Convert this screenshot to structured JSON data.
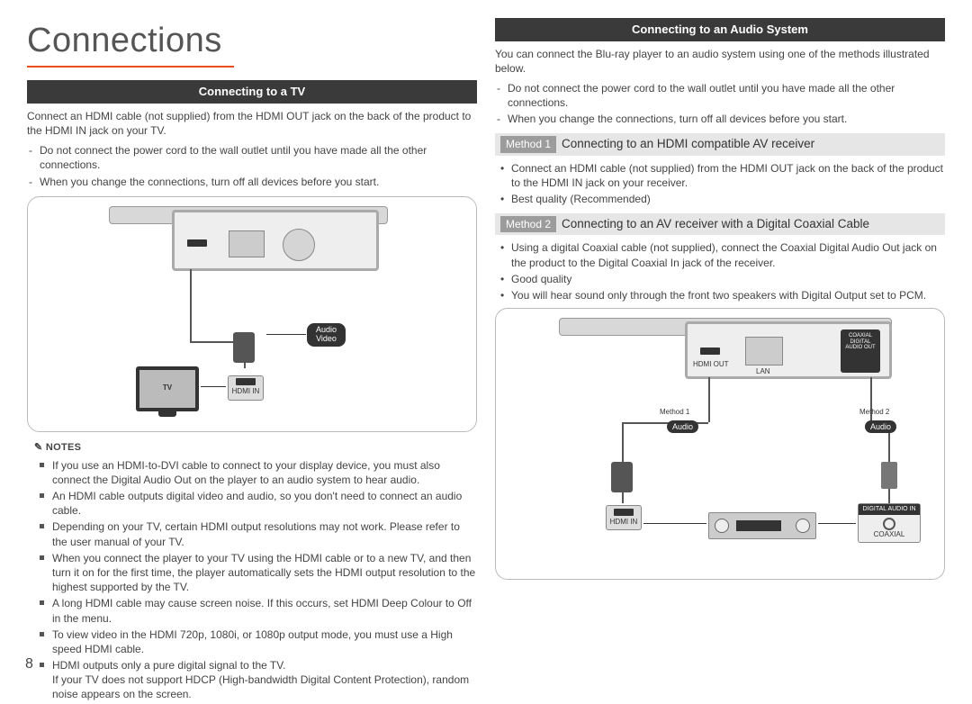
{
  "page_number": "8",
  "title": "Connections",
  "left": {
    "section_header": "Connecting to a TV",
    "intro": "Connect an HDMI cable (not supplied) from the HDMI OUT jack on the back of the product to the HDMI IN jack on your TV.",
    "warnings": [
      "Do not connect the power cord to the wall outlet until you have made all the other connections.",
      "When you change the connections, turn off all devices before you start."
    ],
    "diagram": {
      "label_audio_video": "Audio\nVideo",
      "tv_label": "TV",
      "hdmi_in_label": "HDMI IN"
    },
    "notes_label": "NOTES",
    "notes": [
      "If you use an HDMI-to-DVI cable to connect to your display device, you must also connect the Digital Audio Out on the player to an audio system to hear audio.",
      "An HDMI cable outputs digital video and audio, so you don't need to connect an audio cable.",
      "Depending on your TV, certain HDMI output resolutions may not work. Please refer to the user manual of your TV.",
      "When you connect the player to your TV using the HDMI cable or to a new TV, and then turn it on for the first time, the player automatically sets the HDMI output resolution to the highest supported by the TV.",
      "A long HDMI cable may cause screen noise. If this occurs, set HDMI Deep Colour to Off in the menu.",
      "To view video in the HDMI 720p, 1080i, or 1080p output mode, you must use a High speed HDMI cable.",
      "HDMI outputs only a pure digital signal to the TV.\nIf your TV does not support HDCP (High-bandwidth Digital Content Protection), random noise appears on the screen."
    ]
  },
  "right": {
    "section_header": "Connecting to an Audio System",
    "intro": "You can connect the Blu-ray player to an audio system using one of the methods illustrated below.",
    "warnings": [
      "Do not connect the power cord to the wall outlet until you have made all the other connections.",
      "When you change the connections, turn off all devices before you start."
    ],
    "method1_badge": "Method 1",
    "method1_title": "Connecting to an HDMI compatible AV receiver",
    "method1_bullets": [
      "Connect an HDMI cable (not supplied) from the HDMI OUT jack on the back of the product to the HDMI IN jack on your receiver.",
      "Best quality (Recommended)"
    ],
    "method2_badge": "Method 2",
    "method2_title": "Connecting to an AV receiver with a Digital Coaxial Cable",
    "method2_bullets": [
      "Using a digital Coaxial cable (not supplied), connect the Coaxial Digital Audio Out jack on the product to the Digital Coaxial In jack of the receiver.",
      "Good quality",
      "You will hear sound only through the front two speakers with Digital Output set to PCM."
    ],
    "diagram": {
      "m1_label": "Method 1",
      "m2_label": "Method 2",
      "audio_label": "Audio",
      "hdmi_in_label": "HDMI IN",
      "digital_audio_in": "DIGITAL AUDIO IN",
      "coaxial_label": "COAXIAL",
      "hdmi_out_label": "HDMI OUT",
      "lan_label": "LAN",
      "coax_port_label": "COAXIAL\nDIGITAL\nAUDIO OUT"
    }
  }
}
